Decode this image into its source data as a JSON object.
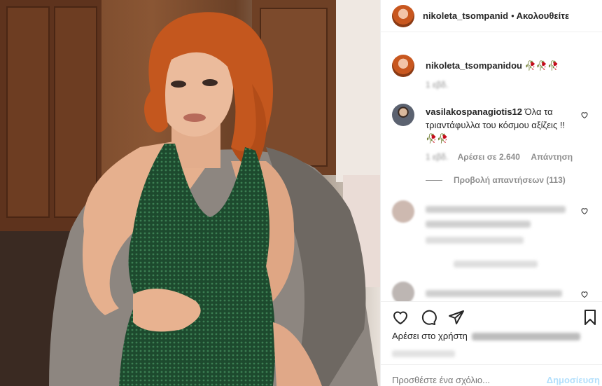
{
  "post": {
    "username": "nikoleta_tsompanid",
    "follow_label": "Ακολουθείτε",
    "dot": "•"
  },
  "caption": {
    "username": "nikoleta_tsompanidou",
    "text": "🥀🥀🥀",
    "time": "1 εβδ."
  },
  "comments": [
    {
      "username": "vasilakospanagiotis12",
      "text": "Όλα τα τριαντάφυλλα του κόσμου αξίζεις !!🥀🥀",
      "time": "1 εβδ.",
      "likes": "Αρέσει σε 2.640",
      "reply": "Απάντηση",
      "view_replies": "Προβολή απαντήσεων (113)"
    }
  ],
  "actions": {
    "likes_prefix": "Αρέσει στο χρήστη"
  },
  "add_comment": {
    "placeholder": "Προσθέστε ένα σχόλιο...",
    "post_label": "Δημοσίευση"
  },
  "colors": {
    "accent_disabled": "#b2dffc",
    "text": "#262626",
    "muted": "#8e8e8e"
  }
}
